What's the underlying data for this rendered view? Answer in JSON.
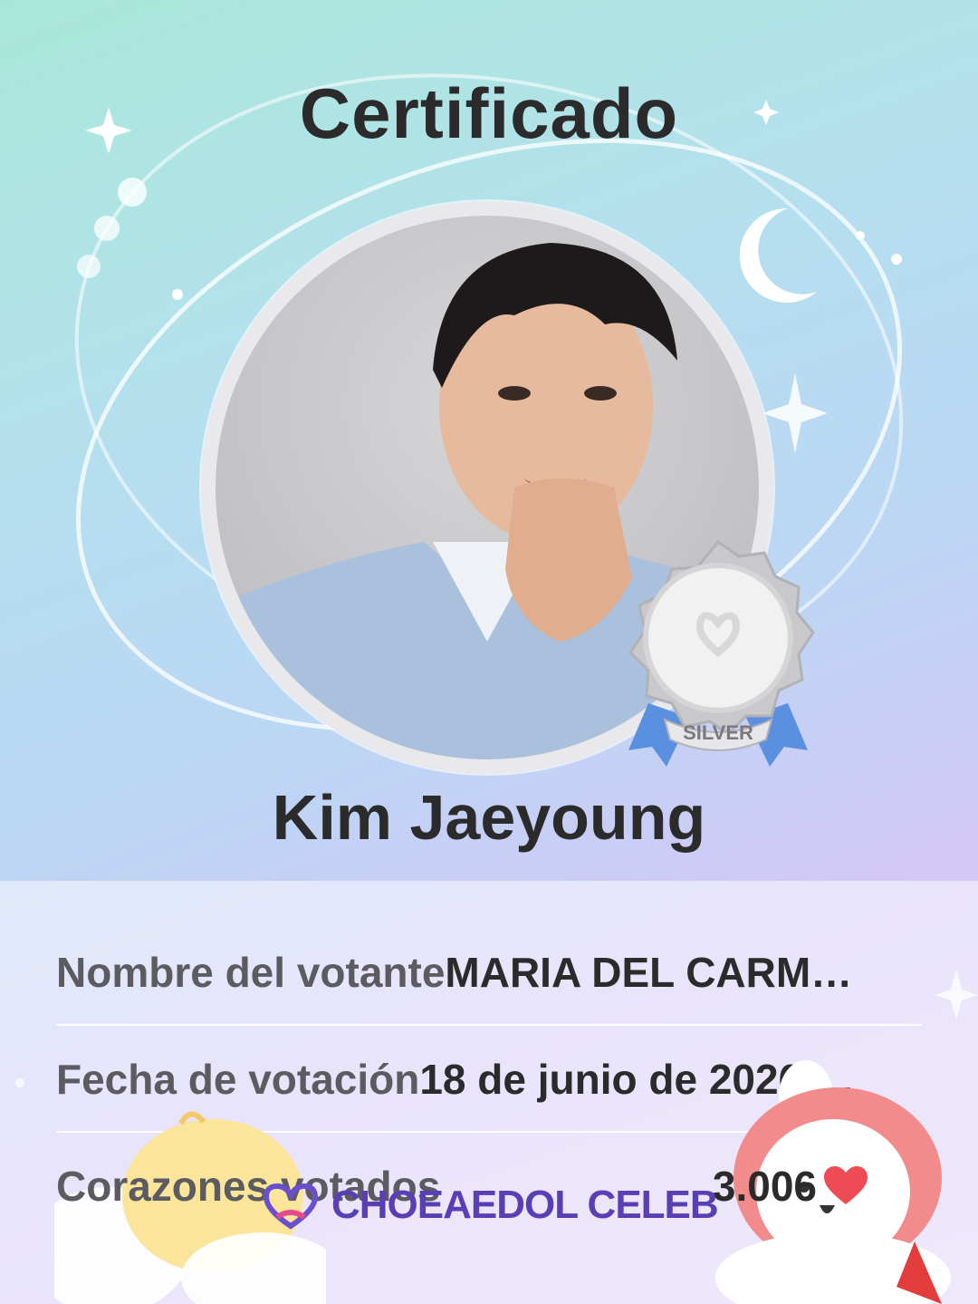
{
  "certificate": {
    "title": "Certificado",
    "celebrity_name": "Kim Jaeyoung",
    "badge_label": "SILVER"
  },
  "details": {
    "voter_label": "Nombre del votante",
    "voter_value": "MARIA DEL CARM…",
    "date_label": "Fecha de votación",
    "date_value": "18 de junio de 2026 …",
    "hearts_label": "Corazones votados",
    "hearts_value": "3.006"
  },
  "brand": {
    "logo_text": "CHOEAEDOL CELEB"
  },
  "colors": {
    "heart": "#ee4b55",
    "logo_purple": "#5a3fb4",
    "badge_ribbon": "#5b8fe0",
    "badge_silver": "#c9c9cc"
  },
  "icons": {
    "heart": "heart-icon",
    "badge": "silver-medal-icon",
    "logo": "choeaedol-logo-icon"
  }
}
